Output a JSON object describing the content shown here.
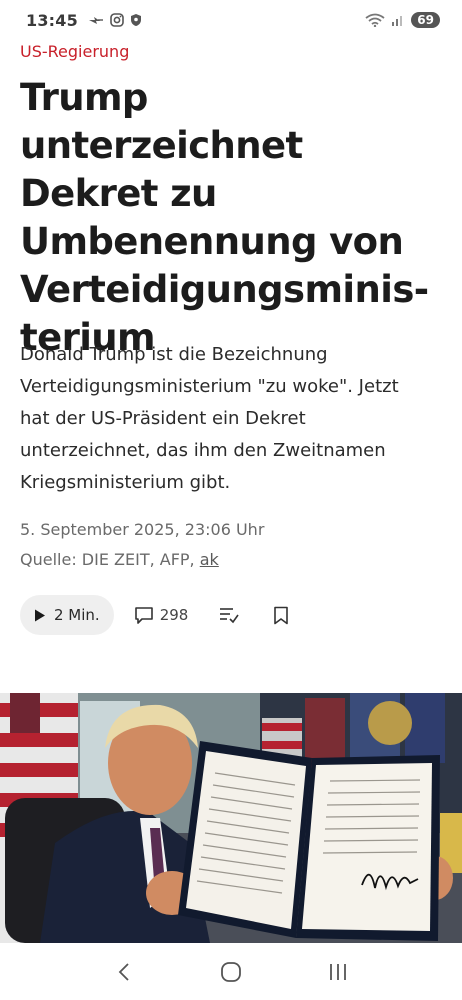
{
  "status_bar": {
    "time": "13:45",
    "battery": "69",
    "icons": [
      "charging-icon",
      "instagram-icon",
      "shield-icon",
      "wifi-icon",
      "signal-icon"
    ]
  },
  "article": {
    "kicker": "US-Regierung",
    "headline_lines": [
      "Trump unterzeichnet",
      "Dekret zu",
      "Umbenennung von",
      "Verteidigungsminis-",
      "terium"
    ],
    "lead_lines": [
      "Donald Trump ist die Bezeichnung",
      "Verteidigungsministerium \"zu woke\". Jetzt",
      "hat der US-Präsident ein Dekret",
      "unterzeichnet, das ihm den Zweitnamen",
      "Kriegsministerium gibt."
    ],
    "date": "5. September 2025, 23:06 Uhr",
    "source_prefix": "Quelle: DIE ZEIT, AFP, ",
    "source_author": "ak"
  },
  "actions": {
    "audio_label": "2 Min.",
    "comment_count": "298"
  },
  "colors": {
    "kicker": "#c8202a",
    "pill_bg": "#efefef"
  }
}
